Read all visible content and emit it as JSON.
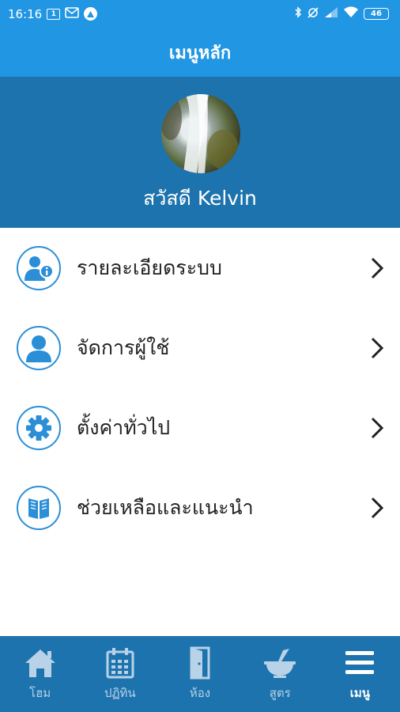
{
  "status_bar": {
    "time": "16:16",
    "sim_badge": "1",
    "battery": "46"
  },
  "app_bar": {
    "title": "เมนูหลัก"
  },
  "profile": {
    "greeting": "สวัสดี Kelvin"
  },
  "menu": {
    "items": [
      {
        "label": "รายละเอียดระบบ",
        "icon": "user-info-icon"
      },
      {
        "label": "จัดการผู้ใช้",
        "icon": "user-icon"
      },
      {
        "label": "ตั้งค่าทั่วไป",
        "icon": "gear-icon"
      },
      {
        "label": "ช่วยเหลือและแนะนำ",
        "icon": "book-icon"
      }
    ]
  },
  "bottom_nav": {
    "items": [
      {
        "label": "โฮม",
        "icon": "home-icon"
      },
      {
        "label": "ปฏิทิน",
        "icon": "calendar-icon"
      },
      {
        "label": "ห้อง",
        "icon": "door-icon"
      },
      {
        "label": "สูตร",
        "icon": "mortar-pestle-icon"
      },
      {
        "label": "เมนู",
        "icon": "menu-icon"
      }
    ],
    "active_index": 4
  },
  "colors": {
    "primary": "#2196e3",
    "primary_dark": "#1d73ad",
    "icon_accent": "#2b8fd8"
  }
}
